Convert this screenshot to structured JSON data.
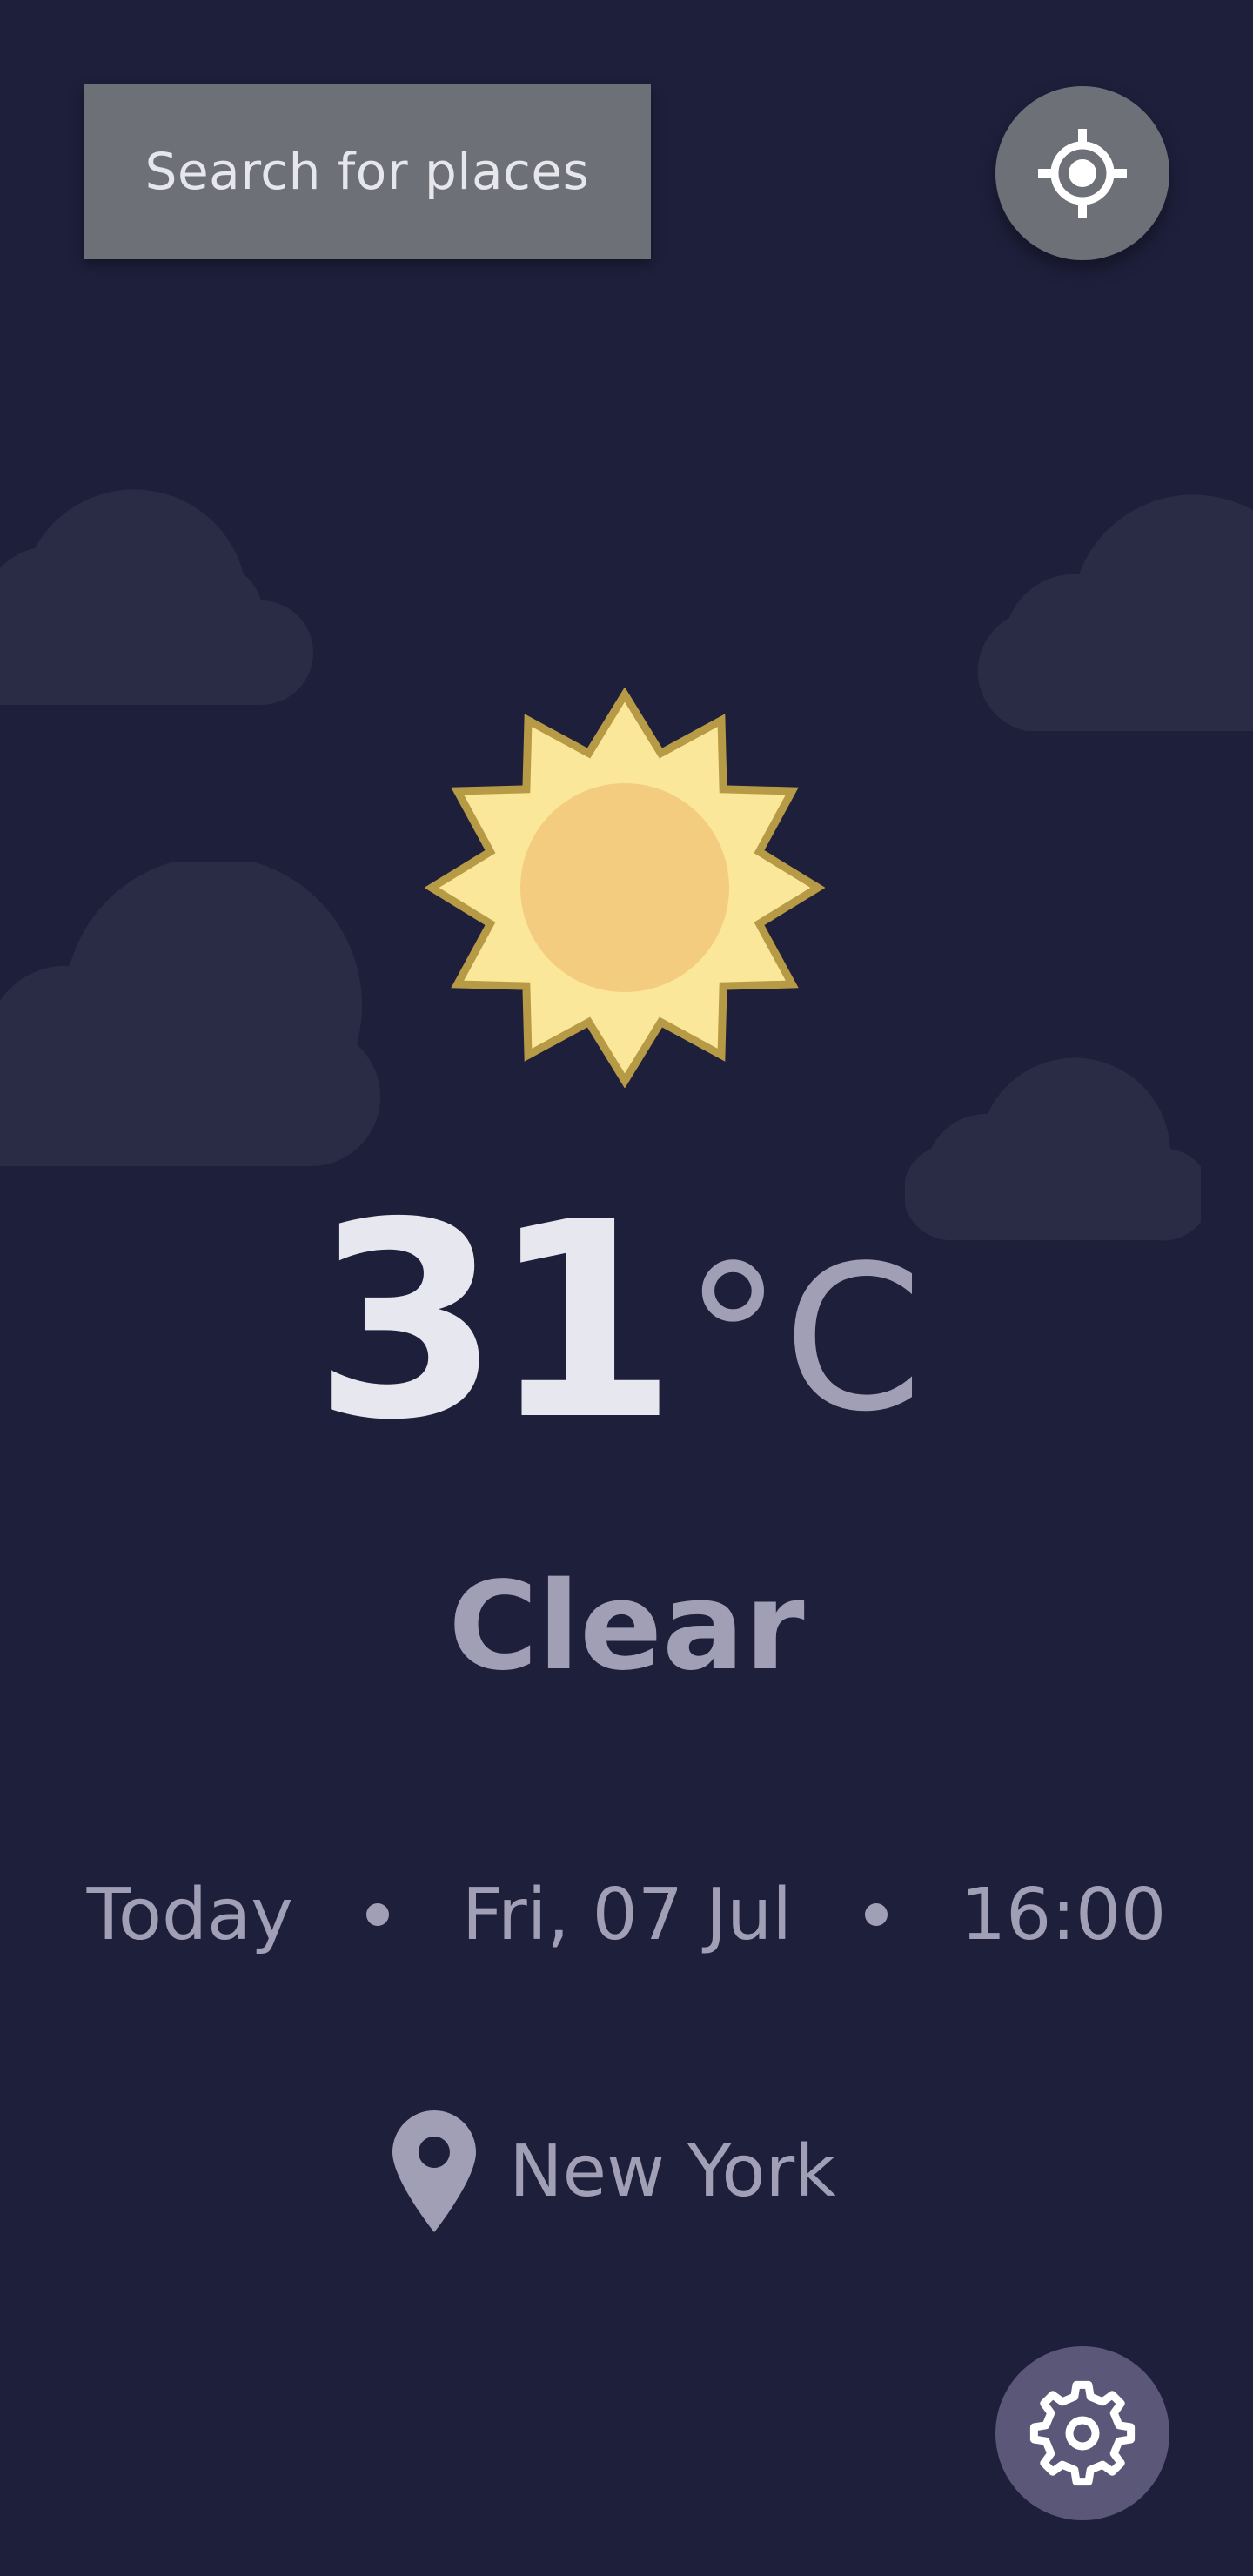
{
  "search": {
    "label": "Search for places"
  },
  "weather": {
    "temperature": "31",
    "unit": "°C",
    "condition": "Clear",
    "day": "Today",
    "date": "Fri, 07 Jul",
    "time": "16:00",
    "location": "New York"
  },
  "icons": {
    "locate": "crosshair-icon",
    "settings": "gear-icon",
    "pin": "map-pin-icon",
    "weather": "sun-icon"
  },
  "colors": {
    "background": "#1e1f3b",
    "cloud": "#2a2b45",
    "button": "#6e7078",
    "settings_button": "#5a5779",
    "text_primary": "#e7e7f0",
    "text_secondary": "#a09fb5"
  }
}
